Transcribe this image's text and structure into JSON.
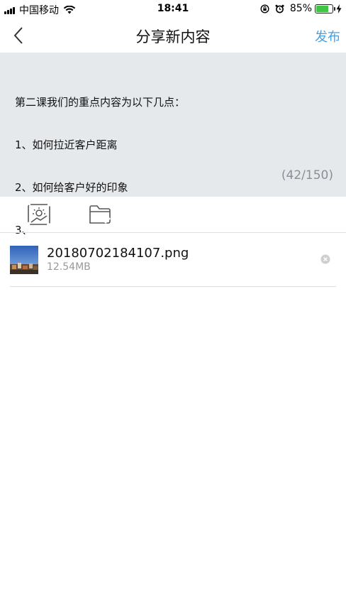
{
  "status_bar": {
    "carrier": "中国移动",
    "time": "18:41",
    "battery_percent": "85%",
    "battery_level": 0.85,
    "icons": [
      "signal-icon",
      "wifi-icon",
      "rotation-lock-icon",
      "alarm-icon",
      "battery-icon",
      "charging-icon"
    ]
  },
  "nav": {
    "title": "分享新内容",
    "publish_label": "发布",
    "back_icon": "chevron-left-icon"
  },
  "compose": {
    "lines": [
      "第二课我们的重点内容为以下几点：",
      "1、如何拉近客户距离",
      "2、如何给客户好的印象",
      "3、"
    ],
    "counter": "(42/150)"
  },
  "toolbar": {
    "tools": [
      "image-icon",
      "folder-icon"
    ]
  },
  "attachment": {
    "file_name": "20180702184107.png",
    "file_size": "12.54MB",
    "remove_icon": "close-circle-icon"
  },
  "colors": {
    "accent": "#4a9fe0",
    "compose_bg": "#e6e9ec",
    "battery": "#3fc444",
    "muted": "#999999"
  }
}
